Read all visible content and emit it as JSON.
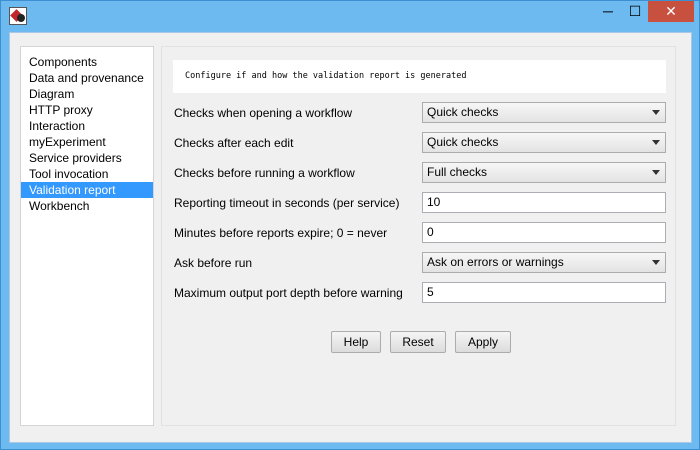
{
  "window": {
    "controls": {
      "minimize": "─",
      "maximize": "☐",
      "close": "✕"
    }
  },
  "sidebar": {
    "items": [
      {
        "label": "Components",
        "selected": false
      },
      {
        "label": "Data and provenance",
        "selected": false
      },
      {
        "label": "Diagram",
        "selected": false
      },
      {
        "label": "HTTP proxy",
        "selected": false
      },
      {
        "label": "Interaction",
        "selected": false
      },
      {
        "label": "myExperiment",
        "selected": false
      },
      {
        "label": "Service providers",
        "selected": false
      },
      {
        "label": "Tool invocation",
        "selected": false
      },
      {
        "label": "Validation report",
        "selected": true
      },
      {
        "label": "Workbench",
        "selected": false
      }
    ]
  },
  "panel": {
    "description": "Configure if and how the validation report is generated",
    "fields": {
      "checks_opening": {
        "label": "Checks when opening a workflow",
        "value": "Quick checks"
      },
      "checks_edit": {
        "label": "Checks after each edit",
        "value": "Quick checks"
      },
      "checks_running": {
        "label": "Checks before running a workflow",
        "value": "Full checks"
      },
      "reporting_timeout": {
        "label": "Reporting timeout in seconds (per service)",
        "value": "10"
      },
      "minutes_expire": {
        "label": "Minutes before reports expire; 0 = never",
        "value": "0"
      },
      "ask_before_run": {
        "label": "Ask before run",
        "value": "Ask on errors or warnings"
      },
      "max_port_depth": {
        "label": "Maximum output port depth before warning",
        "value": "5"
      }
    },
    "buttons": {
      "help": "Help",
      "reset": "Reset",
      "apply": "Apply"
    }
  },
  "colors": {
    "selection": "#3399ff",
    "close_button": "#c7503f",
    "title_bar": "#6cbaf0"
  }
}
